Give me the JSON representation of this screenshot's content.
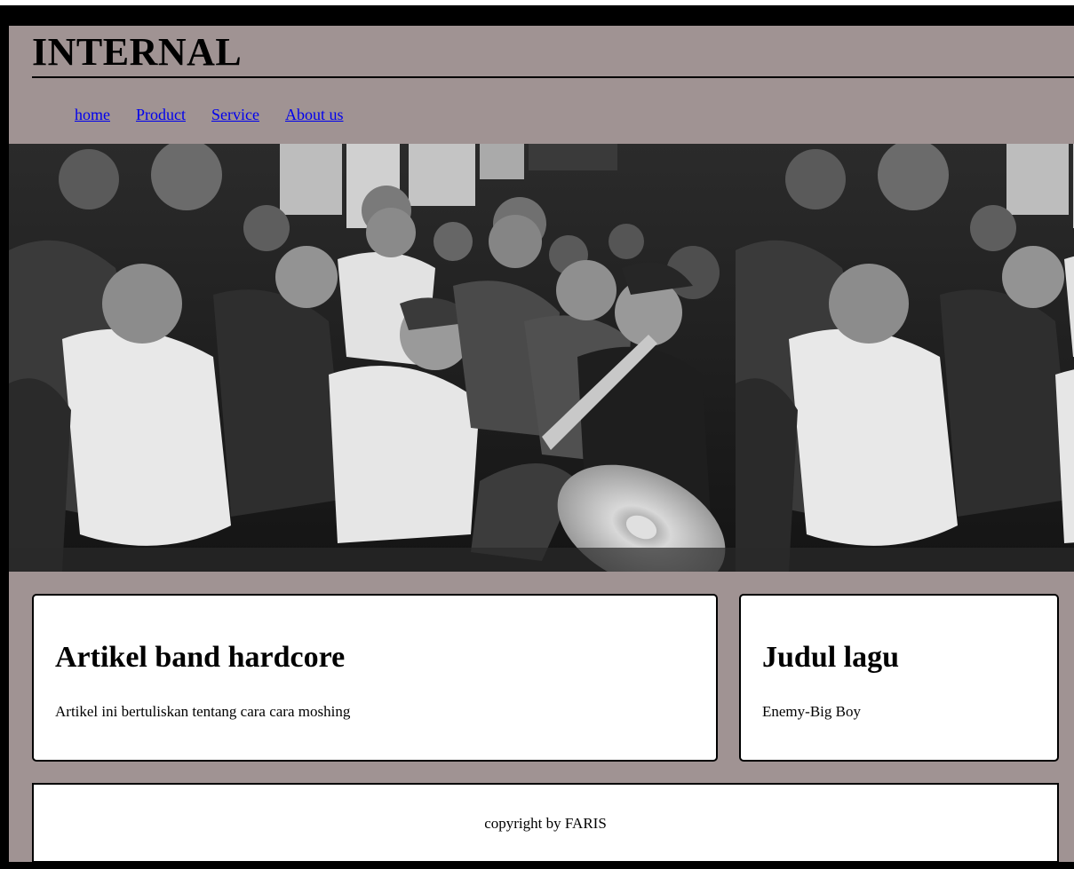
{
  "header": {
    "title": "INTERNAL"
  },
  "nav": {
    "items": [
      {
        "label": "home"
      },
      {
        "label": "Product"
      },
      {
        "label": "Service"
      },
      {
        "label": "About us"
      }
    ]
  },
  "banner": {
    "image": "grayscale-concert-crowd-photo"
  },
  "article": {
    "heading": "Artikel band hardcore",
    "body": "Artikel ini bertuliskan tentang cara cara moshing"
  },
  "song": {
    "heading": "Judul lagu",
    "body": "Enemy-Big Boy"
  },
  "footer": {
    "text": "copyright by FARIS"
  },
  "colors": {
    "page_frame": "#a09393",
    "outer_border": "#000000",
    "card_bg": "#ffffff",
    "link": "#0000ee"
  }
}
